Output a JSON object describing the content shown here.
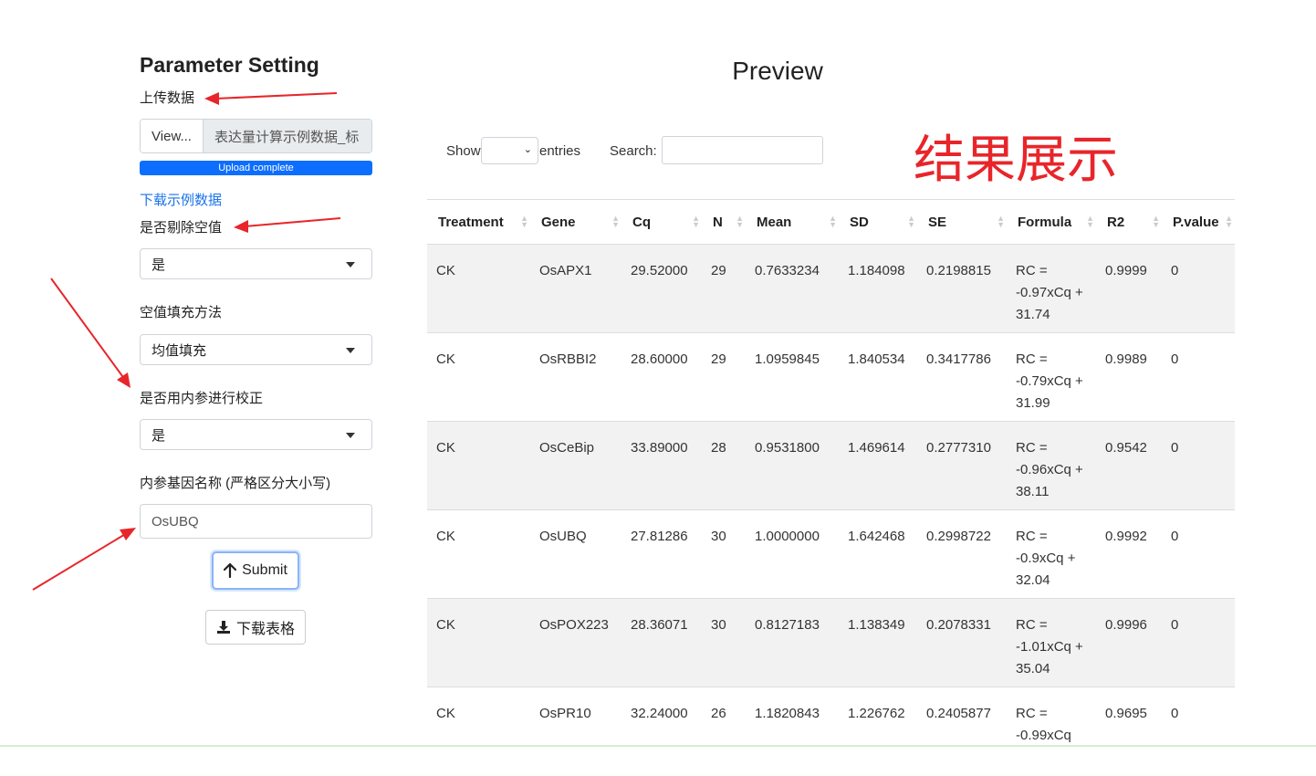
{
  "sidebar": {
    "title": "Parameter Setting",
    "upload_label": "上传数据",
    "browse_label": "View...",
    "file_name": "表达量计算示例数据_标",
    "progress_text": "Upload complete",
    "progress_percent": 100,
    "sample_link": "下载示例数据",
    "remove_empty_label": "是否剔除空值",
    "remove_empty_value": "是",
    "fill_method_label": "空值填充方法",
    "fill_method_value": "均值填充",
    "calibrate_label": "是否用内参进行校正",
    "calibrate_value": "是",
    "ref_gene_label": "内参基因名称 (严格区分大小写)",
    "ref_gene_placeholder": "OsUBQ",
    "submit_label": "Submit",
    "download_label": "下载表格"
  },
  "main": {
    "title": "Preview",
    "show_label": "Show",
    "entries_label": "entries",
    "search_label": "Search:",
    "result_annotation": "结果展示",
    "annotation_color": "#e8252a",
    "accent_color": "#0d6efd"
  },
  "table": {
    "headers": [
      "Treatment",
      "Gene",
      "Cq",
      "N",
      "Mean",
      "SD",
      "SE",
      "Formula",
      "R2",
      "P.value"
    ],
    "rows": [
      [
        "CK",
        "OsAPX1",
        "29.52000",
        "29",
        "0.7633234",
        "1.184098",
        "0.2198815",
        "RC = -0.97xCq + 31.74",
        "0.9999",
        "0"
      ],
      [
        "CK",
        "OsRBBI2",
        "28.60000",
        "29",
        "1.0959845",
        "1.840534",
        "0.3417786",
        "RC = -0.79xCq + 31.99",
        "0.9989",
        "0"
      ],
      [
        "CK",
        "OsCeBip",
        "33.89000",
        "28",
        "0.9531800",
        "1.469614",
        "0.2777310",
        "RC = -0.96xCq + 38.11",
        "0.9542",
        "0"
      ],
      [
        "CK",
        "OsUBQ",
        "27.81286",
        "30",
        "1.0000000",
        "1.642468",
        "0.2998722",
        "RC = -0.9xCq + 32.04",
        "0.9992",
        "0"
      ],
      [
        "CK",
        "OsPOX223",
        "28.36071",
        "30",
        "0.8127183",
        "1.138349",
        "0.2078331",
        "RC = -1.01xCq + 35.04",
        "0.9996",
        "0"
      ],
      [
        "CK",
        "OsPR10",
        "32.24000",
        "26",
        "1.1820843",
        "1.226762",
        "0.2405877",
        "RC = -0.99xCq",
        "0.9695",
        "0"
      ]
    ]
  }
}
